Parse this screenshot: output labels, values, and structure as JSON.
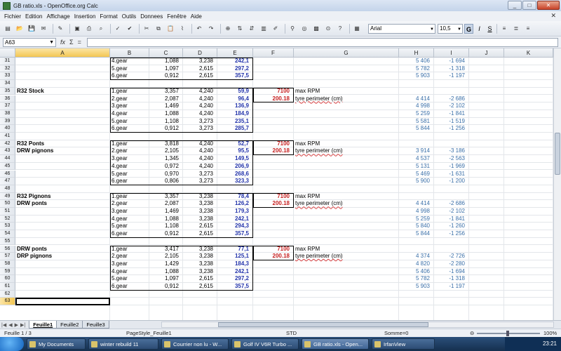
{
  "window": {
    "title": "GB ratio.xls - OpenOffice.org Calc",
    "controls": [
      "_",
      "□",
      "✕"
    ]
  },
  "menu": [
    "Fichier",
    "Edition",
    "Affichage",
    "Insertion",
    "Format",
    "Outils",
    "Donnees",
    "Fenêtre",
    "Aide"
  ],
  "toolbar": {
    "font": "Arial",
    "size": "10,5",
    "bold": "G",
    "italic": "I",
    "underline": "S"
  },
  "formula": {
    "namebox": "A63",
    "fx": "fx",
    "sum": "Σ",
    "equals": "=",
    "content": ""
  },
  "columns": [
    "A",
    "B",
    "C",
    "D",
    "E",
    "F",
    "G",
    "H",
    "I",
    "J",
    "K"
  ],
  "rows": [
    {
      "n": "31",
      "B": "4.gear",
      "C": "1,088",
      "D": "3,238",
      "E": "242,1",
      "H": "5 406",
      "I": "-1 694"
    },
    {
      "n": "32",
      "B": "5.gear",
      "C": "1,097",
      "D": "2,615",
      "E": "297,2",
      "H": "5 782",
      "I": "-1 318"
    },
    {
      "n": "33",
      "B": "6.gear",
      "C": "0,912",
      "D": "2,615",
      "E": "357,5",
      "H": "5 903",
      "I": "-1 197"
    },
    {
      "n": "34"
    },
    {
      "n": "35",
      "A": "R32 Stock",
      "B": "1.gear",
      "C": "3,357",
      "D": "4,240",
      "E": "59,9",
      "F": "7100",
      "G": "max RPM"
    },
    {
      "n": "36",
      "B": "2.gear",
      "C": "2,087",
      "D": "4,240",
      "E": "96,4",
      "F": "200.18",
      "G": "tyre perimeter (cm)",
      "H": "4 414",
      "I": "-2 686"
    },
    {
      "n": "37",
      "B": "3.gear",
      "C": "1,469",
      "D": "4,240",
      "E": "136,9",
      "H": "4 998",
      "I": "-2 102"
    },
    {
      "n": "38",
      "B": "4.gear",
      "C": "1,088",
      "D": "4,240",
      "E": "184,9",
      "H": "5 259",
      "I": "-1 841"
    },
    {
      "n": "39",
      "B": "5.gear",
      "C": "1,108",
      "D": "3,273",
      "E": "235,1",
      "H": "5 581",
      "I": "-1 519"
    },
    {
      "n": "40",
      "B": "6.gear",
      "C": "0,912",
      "D": "3,273",
      "E": "285,7",
      "H": "5 844",
      "I": "-1 256"
    },
    {
      "n": "41"
    },
    {
      "n": "42",
      "A": "R32 Ponts",
      "B": "1.gear",
      "C": "3,818",
      "D": "4,240",
      "E": "52,7",
      "F": "7100",
      "G": "max RPM"
    },
    {
      "n": "43",
      "A": "DRW pignons",
      "B": "2.gear",
      "C": "2,105",
      "D": "4,240",
      "E": "95,5",
      "F": "200.18",
      "G": "tyre perimeter (cm)",
      "H": "3 914",
      "I": "-3 186"
    },
    {
      "n": "44",
      "B": "3.gear",
      "C": "1,345",
      "D": "4,240",
      "E": "149,5",
      "H": "4 537",
      "I": "-2 563"
    },
    {
      "n": "45",
      "B": "4.gear",
      "C": "0,972",
      "D": "4,240",
      "E": "206,9",
      "H": "5 131",
      "I": "-1 969"
    },
    {
      "n": "46",
      "B": "5.gear",
      "C": "0,970",
      "D": "3,273",
      "E": "268,6",
      "H": "5 469",
      "I": "-1 631"
    },
    {
      "n": "47",
      "B": "6.gear",
      "C": "0,806",
      "D": "3,273",
      "E": "323,3",
      "H": "5 900",
      "I": "-1 200"
    },
    {
      "n": "48"
    },
    {
      "n": "49",
      "A": "R32 Pignons",
      "B": "1.gear",
      "C": "3,357",
      "D": "3,238",
      "E": "78,4",
      "F": "7100",
      "G": "max RPM"
    },
    {
      "n": "50",
      "A": "DRW ponts",
      "B": "2.gear",
      "C": "2,087",
      "D": "3,238",
      "E": "126,2",
      "F": "200.18",
      "G": "tyre perimeter (cm)",
      "H": "4 414",
      "I": "-2 686"
    },
    {
      "n": "51",
      "B": "3.gear",
      "C": "1,469",
      "D": "3,238",
      "E": "179,3",
      "H": "4 998",
      "I": "-2 102"
    },
    {
      "n": "52",
      "B": "4.gear",
      "C": "1,088",
      "D": "3,238",
      "E": "242,1",
      "H": "5 259",
      "I": "-1 841"
    },
    {
      "n": "53",
      "B": "5.gear",
      "C": "1,108",
      "D": "2,615",
      "E": "294,3",
      "H": "5 840",
      "I": "-1 260"
    },
    {
      "n": "54",
      "B": "6.gear",
      "C": "0,912",
      "D": "2,615",
      "E": "357,5",
      "H": "5 844",
      "I": "-1 256"
    },
    {
      "n": "55"
    },
    {
      "n": "56",
      "A": "DRW ponts",
      "B": "1.gear",
      "C": "3,417",
      "D": "3,238",
      "E": "77,1",
      "F": "7100",
      "G": "max RPM"
    },
    {
      "n": "57",
      "A": "DRP pignons",
      "B": "2.gear",
      "C": "2,105",
      "D": "3,238",
      "E": "125,1",
      "F": "200.18",
      "G": "tyre perimeter (cm)",
      "H": "4 374",
      "I": "-2 726"
    },
    {
      "n": "58",
      "B": "3.gear",
      "C": "1,429",
      "D": "3,238",
      "E": "184,3",
      "H": "4 820",
      "I": "-2 280"
    },
    {
      "n": "59",
      "B": "4.gear",
      "C": "1,088",
      "D": "3,238",
      "E": "242,1",
      "H": "5 406",
      "I": "-1 694"
    },
    {
      "n": "60",
      "B": "5.gear",
      "C": "1,097",
      "D": "2,615",
      "E": "297,2",
      "H": "5 782",
      "I": "-1 318"
    },
    {
      "n": "61",
      "B": "6.gear",
      "C": "0,912",
      "D": "2,615",
      "E": "357,5",
      "H": "5 903",
      "I": "-1 197"
    },
    {
      "n": "62"
    },
    {
      "n": "63"
    }
  ],
  "sheets": [
    "Feuille1",
    "Feuille2",
    "Feuille3"
  ],
  "status": {
    "sheet": "Feuille 1 / 3",
    "style": "PageStyle_Feuille1",
    "mode": "STD",
    "sum": "Somme=0",
    "zoom": "100%"
  },
  "taskbar": {
    "tasks": [
      "My Documents",
      "winter rebuild 11",
      "Courrier non lu - W...",
      "Golf IV V6R Turbo ...",
      "GB ratio.xls - Open...",
      "IrfanView"
    ],
    "active_index": 4,
    "clock": "23:21"
  }
}
